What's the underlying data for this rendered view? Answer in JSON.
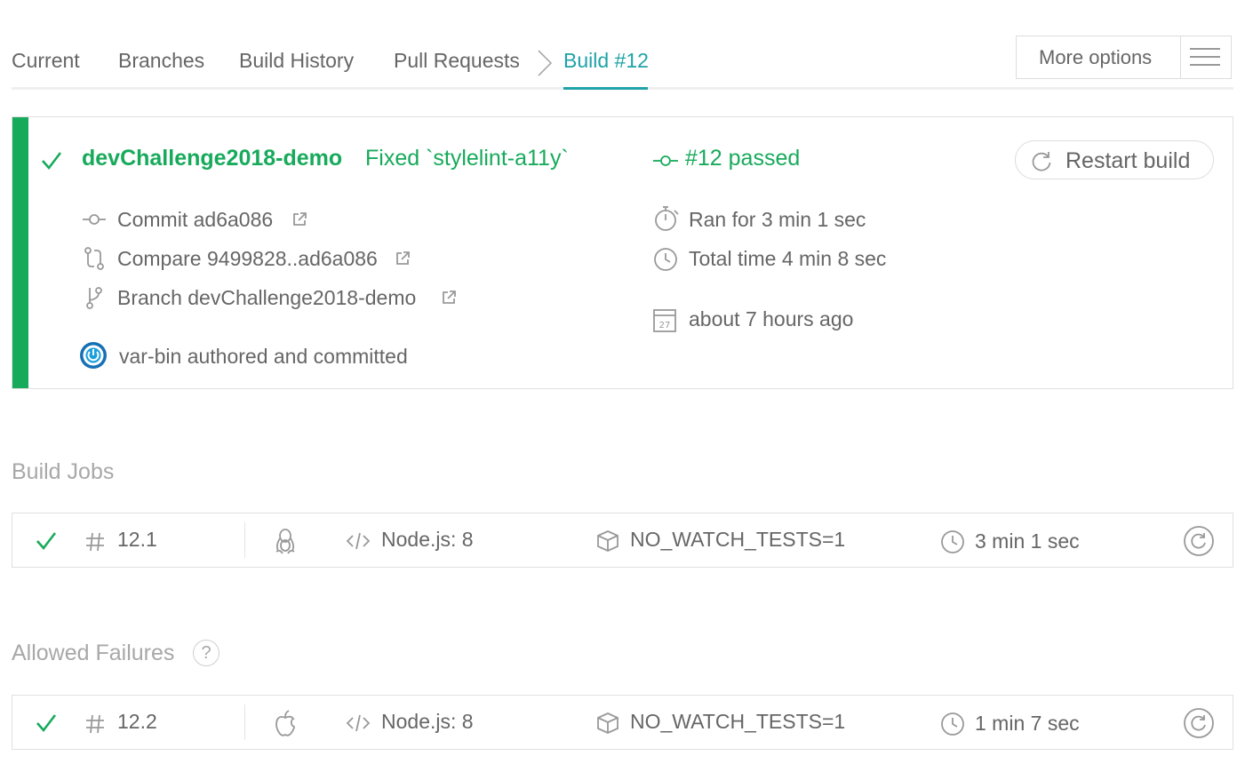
{
  "tabs": {
    "current": "Current",
    "branches": "Branches",
    "build_history": "Build History",
    "pull_requests": "Pull Requests",
    "active": "Build #12"
  },
  "more_options": {
    "label": "More options",
    "icon": "hamburger-menu-icon"
  },
  "summary": {
    "status": "passed",
    "status_color": "#17aa5b",
    "accent_color": "#1fa3a8",
    "branch_name": "devChallenge2018-demo",
    "commit_message": "Fixed `stylelint-a11y`",
    "build_status": "#12 passed",
    "commit": "Commit ad6a086",
    "compare": "Compare 9499828..ad6a086",
    "branch": "Branch devChallenge2018-demo",
    "author": "var-bin authored and committed",
    "ran_for": "Ran for 3 min 1 sec",
    "total_time": "Total time 4 min 8 sec",
    "calendar_day": "27",
    "finished": "about 7 hours ago",
    "restart_label": "Restart build"
  },
  "build_jobs": {
    "title": "Build Jobs",
    "jobs": [
      {
        "number": "12.1",
        "os": "linux",
        "language": "Node.js: 8",
        "env": "NO_WATCH_TESTS=1",
        "duration": "3 min 1 sec"
      }
    ]
  },
  "allowed_failures": {
    "title": "Allowed Failures",
    "help": "?",
    "jobs": [
      {
        "number": "12.2",
        "os": "osx",
        "language": "Node.js: 8",
        "env": "NO_WATCH_TESTS=1",
        "duration": "1 min 7 sec"
      }
    ]
  }
}
